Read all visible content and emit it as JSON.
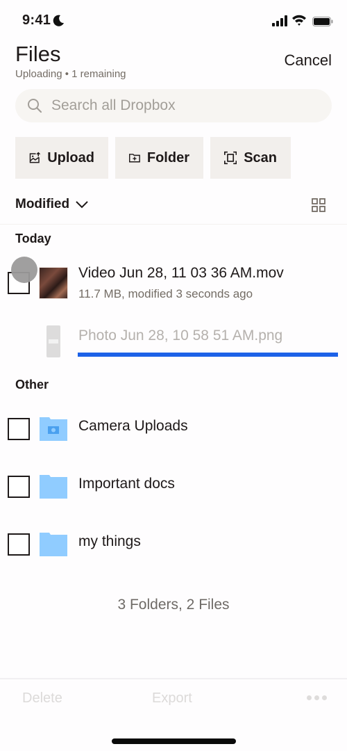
{
  "status_bar": {
    "time": "9:41",
    "icons": [
      "moon-icon",
      "signal-icon",
      "wifi-icon",
      "battery-icon"
    ]
  },
  "header": {
    "title": "Files",
    "subtitle": "Uploading • 1 remaining",
    "cancel_label": "Cancel"
  },
  "search": {
    "placeholder": "Search all Dropbox",
    "value": ""
  },
  "actions": [
    {
      "label": "Upload",
      "icon": "upload-photo-icon"
    },
    {
      "label": "Folder",
      "icon": "new-folder-icon"
    },
    {
      "label": "Scan",
      "icon": "scan-icon"
    }
  ],
  "sort": {
    "label": "Modified",
    "view_toggle_icon": "grid-view-icon"
  },
  "sections": {
    "today": {
      "label": "Today",
      "items": [
        {
          "name": "Video Jun 28, 11 03 36 AM.mov",
          "meta": "11.7 MB, modified 3 seconds ago",
          "type": "video"
        },
        {
          "name": "Photo Jun 28, 10 58 51 AM.png",
          "type": "photo",
          "upload_progress": 1.0
        }
      ]
    },
    "other": {
      "label": "Other",
      "items": [
        {
          "name": "Camera Uploads",
          "type": "camera-folder"
        },
        {
          "name": "Important docs",
          "type": "folder"
        },
        {
          "name": "my things",
          "type": "folder"
        }
      ]
    }
  },
  "footer": {
    "count": "3 Folders, 2 Files"
  },
  "bottom_bar": {
    "delete_label": "Delete",
    "export_label": "Export",
    "more_icon": "more-icon"
  },
  "colors": {
    "accent": "#1c62e8",
    "folder": "#90ccff",
    "text": "#1e1919",
    "muted": "#736c64"
  }
}
